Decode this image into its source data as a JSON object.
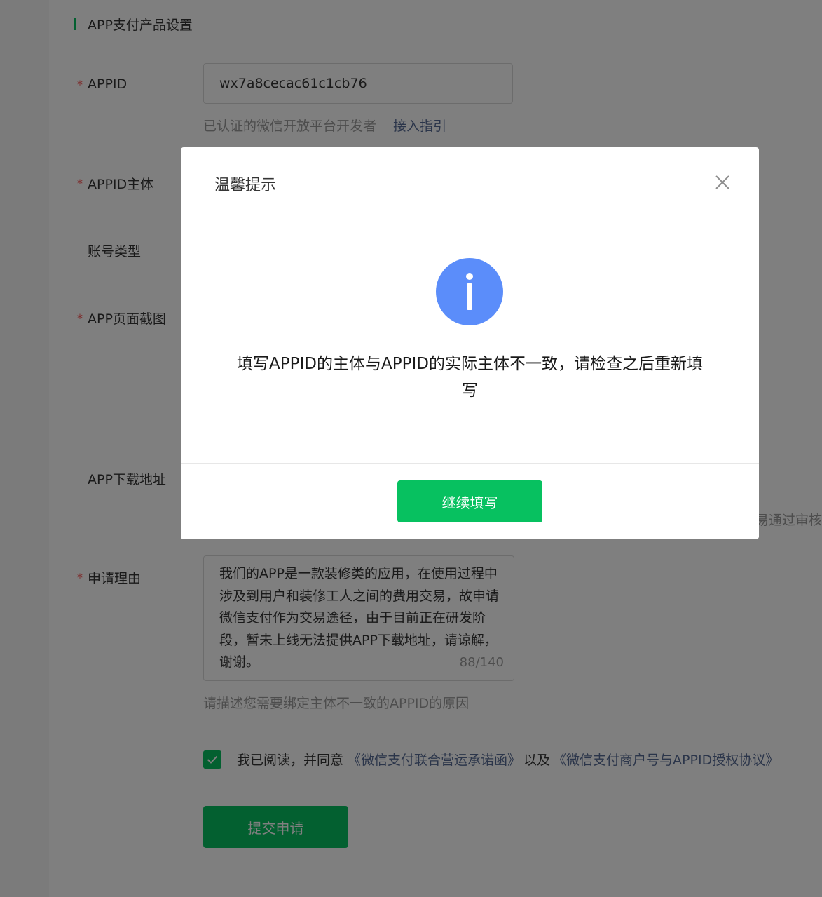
{
  "section": {
    "title": "APP支付产品设置"
  },
  "form": {
    "appid_label": "APPID",
    "appid_value": "wx7a8cecac61c1cb76",
    "appid_hint": "已认证的微信开放平台开发者",
    "appid_link": "接入指引",
    "appid_subject_label": "APPID主体",
    "account_type_label": "账号类型",
    "screenshot_label": "APP页面截图",
    "download_label": "APP下载地址",
    "download_hint_trailing": "易通过审核",
    "reason_label": "申请理由",
    "reason_text": "我们的APP是一款装修类的应用，在使用过程中涉及到用户和装修工人之间的费用交易，故申请微信支付作为交易途径，由于目前正在研发阶段，暂未上线无法提供APP下载地址，请谅解，谢谢。",
    "reason_counter": "88/140",
    "reason_hint": "请描述您需要绑定主体不一致的APPID的原因",
    "required_mark": "*"
  },
  "agreement": {
    "checked": true,
    "text": "我已阅读，并同意",
    "link1": "《微信支付联合营运承诺函》",
    "and": "以及",
    "link2": "《微信支付商户号与APPID授权协议》"
  },
  "submit": {
    "label": "提交申请"
  },
  "dialog": {
    "title": "温馨提示",
    "icon": "info-icon",
    "message": "填写APPID的主体与APPID的实际主体不一致，请检查之后重新填写",
    "continue_label": "继续填写"
  },
  "colors": {
    "brand_green": "#07c160",
    "info_blue": "#5b8dfa",
    "link_blue": "#576b95",
    "required_red": "#fa5151"
  }
}
